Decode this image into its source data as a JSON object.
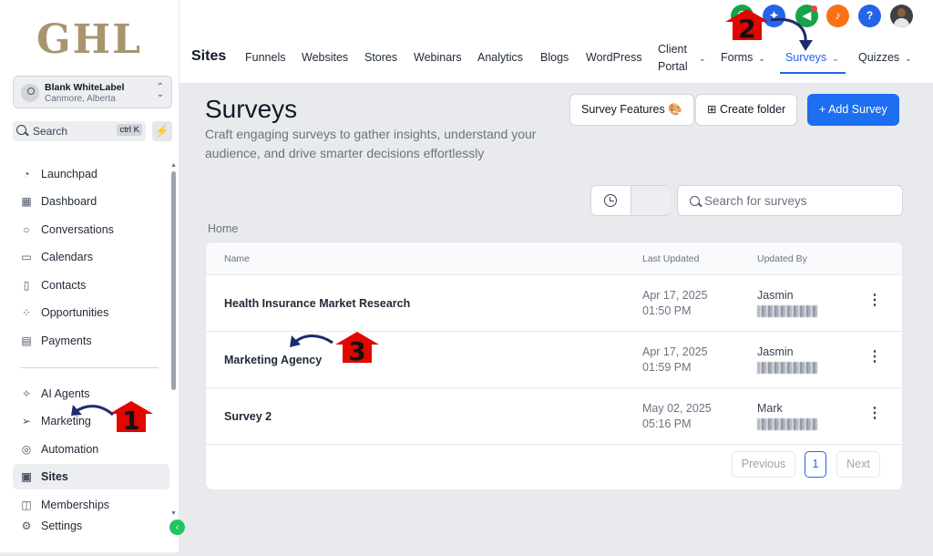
{
  "logo": "GHL",
  "account": {
    "name": "Blank WhiteLabel",
    "location": "Canmore, Alberta"
  },
  "sidebar_search": {
    "label": "Search",
    "shortcut": "ctrl K"
  },
  "nav": [
    {
      "label": "Launchpad",
      "icon": "rocket-icon"
    },
    {
      "label": "Dashboard",
      "icon": "dashboard-icon"
    },
    {
      "label": "Conversations",
      "icon": "chat-icon"
    },
    {
      "label": "Calendars",
      "icon": "calendar-icon"
    },
    {
      "label": "Contacts",
      "icon": "contacts-icon"
    },
    {
      "label": "Opportunities",
      "icon": "opportunities-icon"
    },
    {
      "label": "Payments",
      "icon": "payments-icon"
    },
    {
      "label": "AI Agents",
      "icon": "sparkle-icon"
    },
    {
      "label": "Marketing",
      "icon": "send-icon"
    },
    {
      "label": "Automation",
      "icon": "automation-icon"
    },
    {
      "label": "Sites",
      "icon": "sites-icon",
      "active": true
    },
    {
      "label": "Memberships",
      "icon": "memberships-icon"
    },
    {
      "label": "Settings",
      "icon": "gear-icon"
    }
  ],
  "topbar": {
    "title": "Sites",
    "tabs": [
      "Funnels",
      "Websites",
      "Stores",
      "Webinars",
      "Analytics",
      "Blogs",
      "WordPress",
      "Client Portal",
      "Forms",
      "Surveys",
      "Quizzes"
    ],
    "client_portal_line1": "Client",
    "client_portal_line2": "Portal",
    "active_tab": "Surveys",
    "help_label": "?"
  },
  "page": {
    "title": "Surveys",
    "description": "Craft engaging surveys to gather insights, understand your audience, and drive smarter decisions effortlessly",
    "buttons": {
      "features": "Survey Features 🎨",
      "create_folder": "Create folder",
      "add_survey": "+ Add Survey"
    },
    "search_placeholder": "Search for surveys",
    "breadcrumb": "Home"
  },
  "table": {
    "columns": [
      "Name",
      "Last Updated",
      "Updated By"
    ],
    "rows": [
      {
        "name": "Health Insurance Market Research",
        "date": "Apr 17, 2025",
        "time": "01:50 PM",
        "user": "Jasmin"
      },
      {
        "name": "Marketing Agency",
        "date": "Apr 17, 2025",
        "time": "01:59 PM",
        "user": "Jasmin"
      },
      {
        "name": "Survey 2",
        "date": "May 02, 2025",
        "time": "05:16 PM",
        "user": "Mark"
      }
    ]
  },
  "pagination": {
    "previous": "Previous",
    "current": "1",
    "next": "Next"
  },
  "annotations": [
    "1",
    "2",
    "3"
  ],
  "colors": {
    "accent": "#1d6ef0",
    "annotation_red": "#e10600",
    "arrow_navy": "#1e2a6e"
  }
}
